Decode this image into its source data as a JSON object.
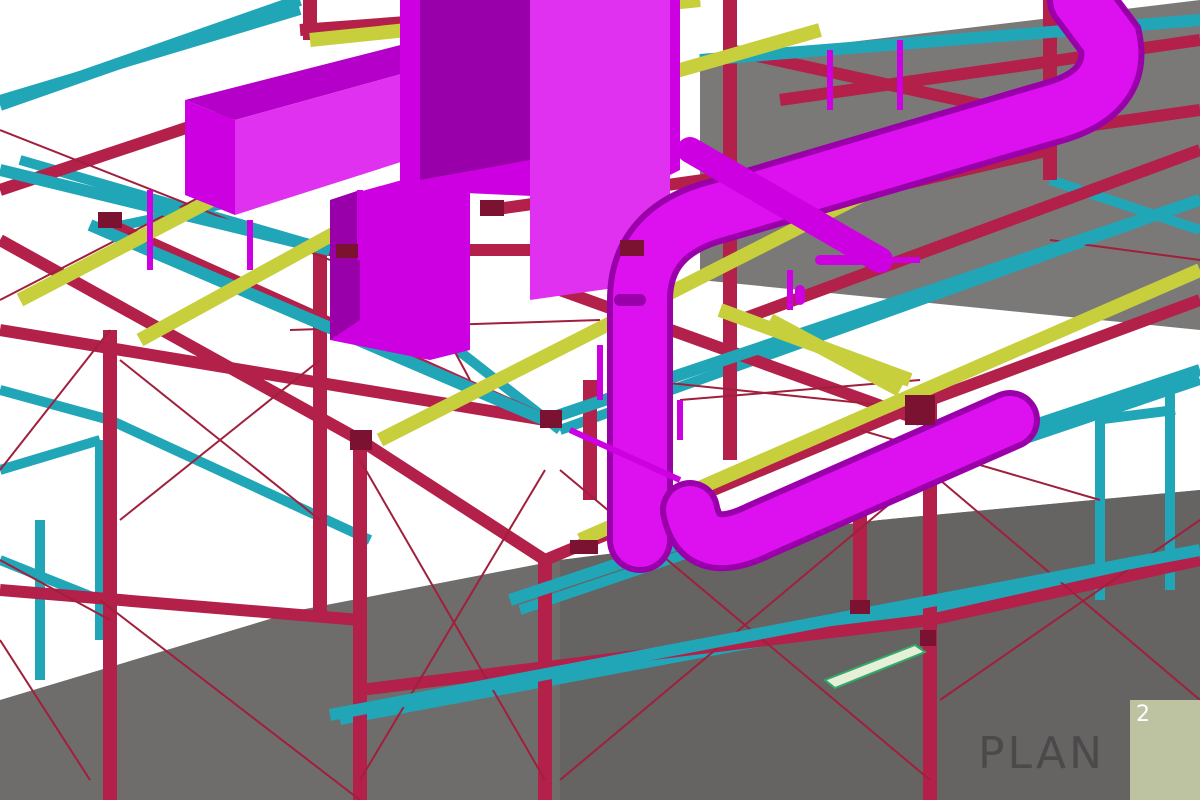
{
  "view": {
    "background_color": "#ffffff",
    "floor_color": "#6f6c6c",
    "colors": {
      "frame": "#b3204a",
      "frame_dark": "#7c1232",
      "secondary_beam": "#21a6b8",
      "purlin": "#c8cf3c",
      "duct": "#cc00e0",
      "duct_dark": "#9a00aa",
      "bracing": "#a0203c"
    }
  },
  "logo": {
    "word": "PLAN",
    "superscript": "2",
    "plate_color": "#cdd2aa",
    "text_color": "#4a4a4a"
  }
}
